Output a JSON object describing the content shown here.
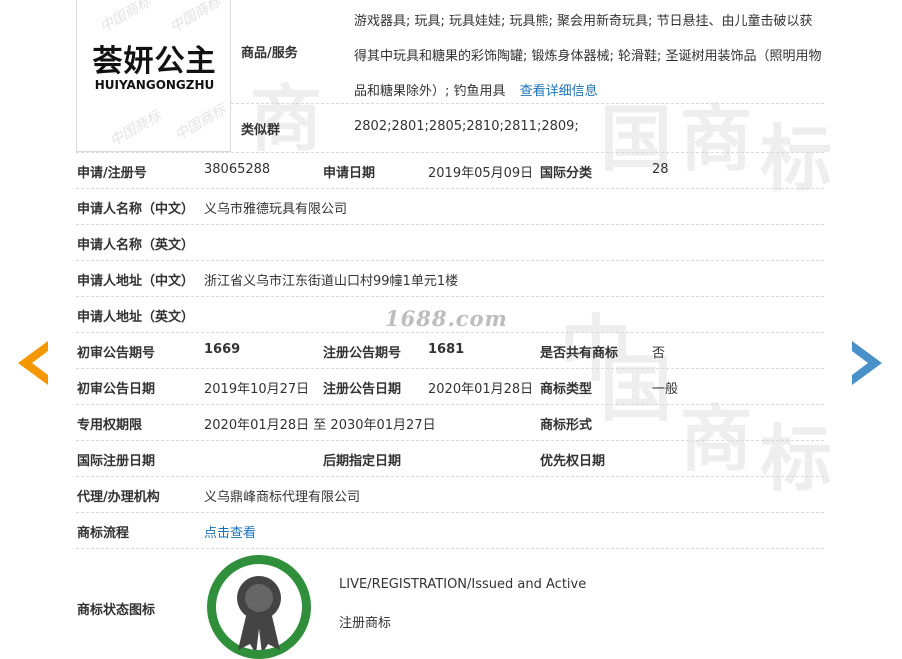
{
  "logo": {
    "cn_text": "荟妍公主",
    "en_text": "HUIYANGONGZHU"
  },
  "goods": {
    "label": "商品/服务",
    "text": "游戏器具; 玩具; 玩具娃娃; 玩具熊; 聚会用新奇玩具; 节日悬挂、由儿童击破以获得其中玩具和糖果的彩饰陶罐; 锻炼身体器械; 轮滑鞋; 圣诞树用装饰品（照明用物品和糖果除外）; 钓鱼用具",
    "detail_link": "查看详细信息"
  },
  "similar_group": {
    "label": "类似群",
    "value": "2802;2801;2805;2810;2811;2809;"
  },
  "rows": {
    "reg_no_label": "申请/注册号",
    "reg_no": "38065288",
    "apply_date_label": "申请日期",
    "apply_date": "2019年05月09日",
    "intl_class_label": "国际分类",
    "intl_class": "28",
    "applicant_cn_label": "申请人名称（中文）",
    "applicant_cn": "义乌市雅德玩具有限公司",
    "applicant_en_label": "申请人名称（英文）",
    "address_cn_label": "申请人地址（中文）",
    "address_cn": "浙江省义乌市江东街道山口村99幢1单元1楼",
    "address_en_label": "申请人地址（英文）",
    "prelim_no_label": "初审公告期号",
    "prelim_no": "1669",
    "reg_pub_no_label": "注册公告期号",
    "reg_pub_no": "1681",
    "shared_label": "是否共有商标",
    "shared": "否",
    "prelim_date_label": "初审公告日期",
    "prelim_date": "2019年10月27日",
    "reg_pub_date_label": "注册公告日期",
    "reg_pub_date": "2020年01月28日",
    "tm_type_label": "商标类型",
    "tm_type": "一般",
    "exclusive_label": "专用权期限",
    "exclusive": "2020年01月28日 至 2030年01月27日",
    "tm_form_label": "商标形式",
    "intl_reg_date_label": "国际注册日期",
    "later_date_label": "后期指定日期",
    "priority_date_label": "优先权日期",
    "agency_label": "代理/办理机构",
    "agency": "义乌鼎峰商标代理有限公司",
    "flow_label": "商标流程",
    "flow_link": "点击查看",
    "status_label": "商标状态图标",
    "status_en": "LIVE/REGISTRATION/Issued and Active",
    "status_cn": "注册商标"
  },
  "watermark": {
    "site": "1688.com",
    "chars": [
      "中",
      "国",
      "商",
      "标"
    ],
    "small": "中国商标"
  },
  "colors": {
    "arrow_left": "#f39800",
    "arrow_right": "#4a90c9",
    "link": "#1a73b8",
    "badge_green": "#2f8f3a"
  }
}
